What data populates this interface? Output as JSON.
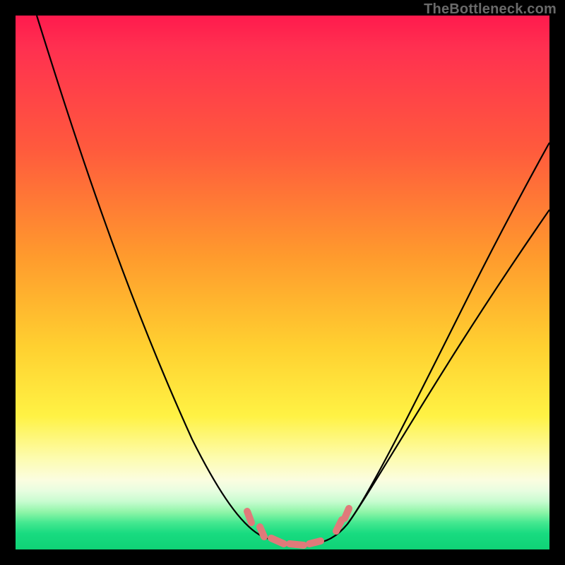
{
  "watermark": "TheBottleneck.com",
  "chart_data": {
    "type": "line",
    "title": "",
    "xlabel": "",
    "ylabel": "",
    "xlim": [
      0,
      100
    ],
    "ylim": [
      0,
      100
    ],
    "grid": false,
    "legend": false,
    "series": [
      {
        "name": "bottleneck-curve",
        "x": [
          4,
          8,
          12,
          16,
          20,
          24,
          28,
          32,
          36,
          40,
          42,
          44,
          46,
          48,
          50,
          52,
          54,
          56,
          58,
          62,
          68,
          76,
          84,
          92,
          100
        ],
        "y": [
          100,
          91,
          82,
          73,
          65,
          56,
          48,
          40,
          32,
          23,
          18,
          13,
          9,
          5,
          3,
          2,
          2,
          2,
          3,
          6,
          12,
          23,
          36,
          50,
          63
        ]
      },
      {
        "name": "highlight-markers",
        "x": [
          44,
          46,
          48,
          50,
          52,
          54,
          56,
          58,
          60
        ],
        "y": [
          8,
          5,
          3,
          2,
          2,
          2,
          2,
          3,
          5
        ]
      }
    ],
    "colors": {
      "curve": "#000000",
      "marker": "#e07a7a",
      "gradient_top": "#ff1a4d",
      "gradient_mid": "#ffe040",
      "gradient_bottom": "#0fd276",
      "frame": "#000000"
    },
    "annotations": []
  }
}
